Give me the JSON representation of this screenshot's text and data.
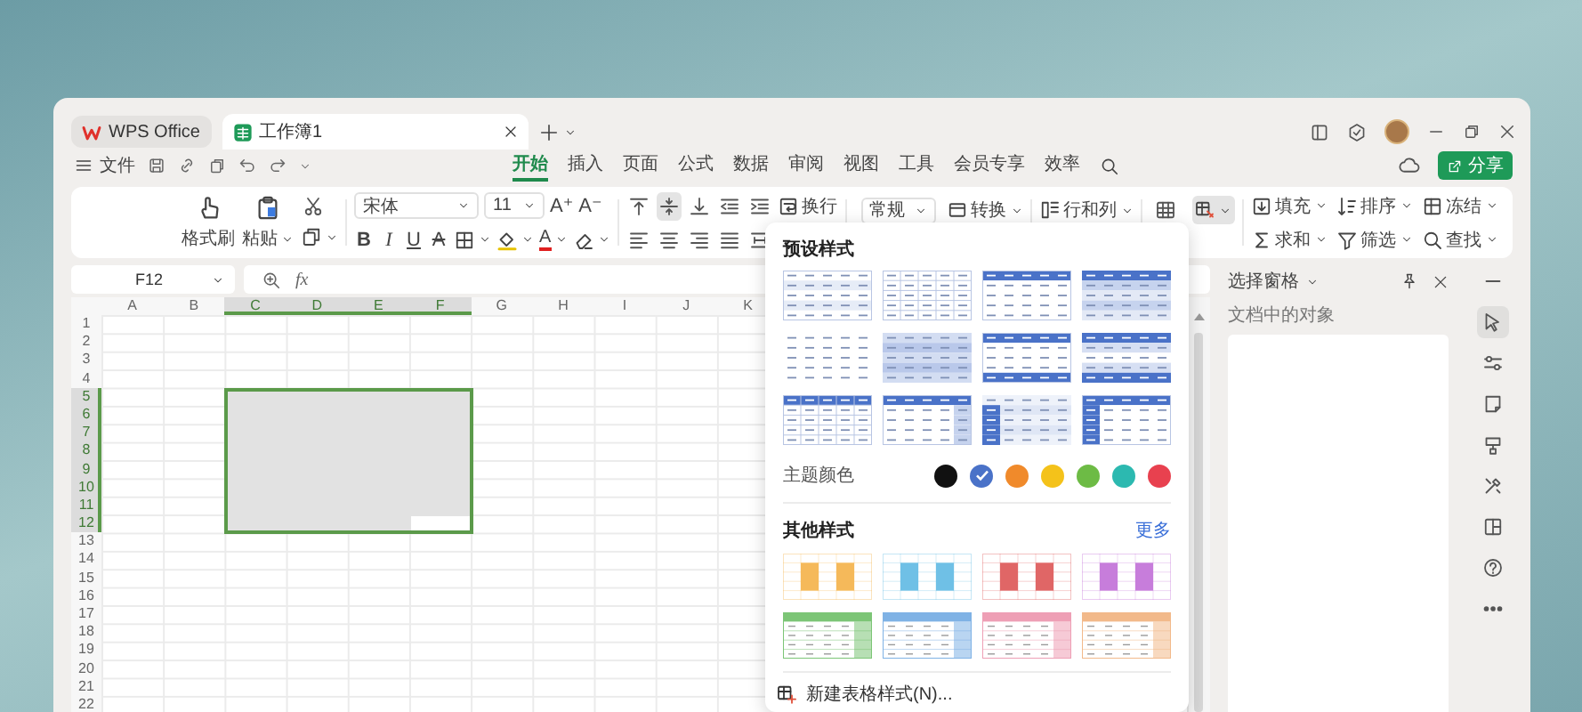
{
  "title_tabs": [
    {
      "label": "WPS Office",
      "kind": "home",
      "selected": false
    },
    {
      "label": "工作簿1",
      "kind": "sheet",
      "selected": true
    }
  ],
  "menu": {
    "label": "文件"
  },
  "ribbon_tabs": [
    {
      "label": "开始",
      "selected": true
    },
    {
      "label": "插入",
      "selected": false
    },
    {
      "label": "页面",
      "selected": false
    },
    {
      "label": "公式",
      "selected": false
    },
    {
      "label": "数据",
      "selected": false
    },
    {
      "label": "审阅",
      "selected": false
    },
    {
      "label": "视图",
      "selected": false
    },
    {
      "label": "工具",
      "selected": false
    },
    {
      "label": "会员专享",
      "selected": false
    },
    {
      "label": "效率",
      "selected": false
    }
  ],
  "share_button": "分享",
  "ribbon": {
    "format_painter": "格式刷",
    "paste": "粘贴",
    "font_name": "宋体",
    "font_size": "11",
    "grow_font": "A⁺",
    "shrink_font": "A⁻",
    "styles": [
      {
        "text": "B",
        "kind": "bold"
      },
      {
        "text": "I",
        "kind": "italic"
      },
      {
        "text": "U",
        "kind": "underline"
      },
      {
        "text": "A",
        "kind": "strike"
      }
    ],
    "font_color": "A",
    "align_rows": [
      [
        {
          "kind": "top",
          "selected": false
        },
        {
          "kind": "middle",
          "selected": true
        },
        {
          "kind": "bottom",
          "selected": false
        },
        {
          "kind": "indent-decrease",
          "selected": false
        },
        {
          "kind": "indent-increase",
          "selected": false
        }
      ],
      [
        {
          "kind": "left",
          "selected": false
        },
        {
          "kind": "center",
          "selected": false
        },
        {
          "kind": "right",
          "selected": false
        },
        {
          "kind": "justify",
          "selected": false
        },
        {
          "kind": "distributed",
          "selected": false
        }
      ]
    ],
    "wrap": "换行",
    "number_format": "常规",
    "convert": "转换",
    "rows_cols": "行和列",
    "editing": [
      {
        "label": "填充",
        "kind": "fill"
      },
      {
        "label": "排序",
        "kind": "sort"
      },
      {
        "label": "冻结",
        "kind": "freeze"
      },
      {
        "label": "求和",
        "kind": "sum"
      },
      {
        "label": "筛选",
        "kind": "filter"
      },
      {
        "label": "查找",
        "kind": "find"
      }
    ]
  },
  "formula_bar": {
    "name_box": "F12",
    "fx": "fx"
  },
  "sheet": {
    "columns": [
      {
        "label": "A",
        "selected": false
      },
      {
        "label": "B",
        "selected": false
      },
      {
        "label": "C",
        "selected": true
      },
      {
        "label": "D",
        "selected": true
      },
      {
        "label": "E",
        "selected": true
      },
      {
        "label": "F",
        "selected": true
      },
      {
        "label": "G",
        "selected": false
      },
      {
        "label": "H",
        "selected": false
      },
      {
        "label": "I",
        "selected": false
      },
      {
        "label": "J",
        "selected": false
      },
      {
        "label": "K",
        "selected": false
      }
    ],
    "rows": [
      {
        "label": "1",
        "selected": false
      },
      {
        "label": "2",
        "selected": false
      },
      {
        "label": "3",
        "selected": false
      },
      {
        "label": "4",
        "selected": false
      },
      {
        "label": "5",
        "selected": true
      },
      {
        "label": "6",
        "selected": true
      },
      {
        "label": "7",
        "selected": true
      },
      {
        "label": "8",
        "selected": true
      },
      {
        "label": "9",
        "selected": true
      },
      {
        "label": "10",
        "selected": true
      },
      {
        "label": "11",
        "selected": true
      },
      {
        "label": "12",
        "selected": true
      },
      {
        "label": "13",
        "selected": false
      },
      {
        "label": "14",
        "selected": false
      },
      {
        "label": "15",
        "selected": false
      },
      {
        "label": "16",
        "selected": false
      },
      {
        "label": "17",
        "selected": false
      },
      {
        "label": "18",
        "selected": false
      },
      {
        "label": "19",
        "selected": false
      },
      {
        "label": "20",
        "selected": false
      },
      {
        "label": "21",
        "selected": false
      },
      {
        "label": "22",
        "selected": false
      }
    ]
  },
  "table_style_menu": {
    "title": "预设样式",
    "presets": [
      {
        "kind": "banded-lines"
      },
      {
        "kind": "grid"
      },
      {
        "kind": "header"
      },
      {
        "kind": "header-banded-dark"
      },
      {
        "kind": "plain"
      },
      {
        "kind": "banded-medium"
      },
      {
        "kind": "header-total"
      },
      {
        "kind": "header-banded-total"
      },
      {
        "kind": "header-outline"
      },
      {
        "kind": "header-last-col"
      },
      {
        "kind": "first-col-banded"
      },
      {
        "kind": "header-first-col"
      }
    ],
    "theme_label": "主题颜色",
    "theme_colors": [
      {
        "color": "#111111",
        "selected": false
      },
      {
        "color": "#4a72c8",
        "selected": true
      },
      {
        "color": "#f08a2b",
        "selected": false
      },
      {
        "color": "#f4c21a",
        "selected": false
      },
      {
        "color": "#6dbb45",
        "selected": false
      },
      {
        "color": "#2cb9b0",
        "selected": false
      },
      {
        "color": "#e8414f",
        "selected": false
      }
    ],
    "other_title": "其他样式",
    "more_link": "更多",
    "other_styles": [
      {
        "kind": "blocks",
        "color": "#f5b95a"
      },
      {
        "kind": "blocks",
        "color": "#6fc0e6"
      },
      {
        "kind": "blocks",
        "color": "#e06666"
      },
      {
        "kind": "blocks",
        "color": "#c77ddb"
      },
      {
        "kind": "header-last-col",
        "color": "#7cc576"
      },
      {
        "kind": "header-last-col",
        "color": "#7fb2e5"
      },
      {
        "kind": "header-last-col",
        "color": "#ee9fb5"
      },
      {
        "kind": "header-last-col",
        "color": "#f2b98a"
      }
    ],
    "new_style": "新建表格样式(N)..."
  },
  "selection_pane": {
    "title": "选择窗格",
    "subtitle": "文档中的对象"
  },
  "side_tools": [
    {
      "kind": "collapse",
      "selected": false
    },
    {
      "kind": "select",
      "selected": true
    },
    {
      "kind": "adjust",
      "selected": false
    },
    {
      "kind": "note",
      "selected": false
    },
    {
      "kind": "style",
      "selected": false
    },
    {
      "kind": "tools",
      "selected": false
    },
    {
      "kind": "layout",
      "selected": false
    },
    {
      "kind": "help",
      "selected": false
    },
    {
      "kind": "more",
      "selected": false
    }
  ]
}
